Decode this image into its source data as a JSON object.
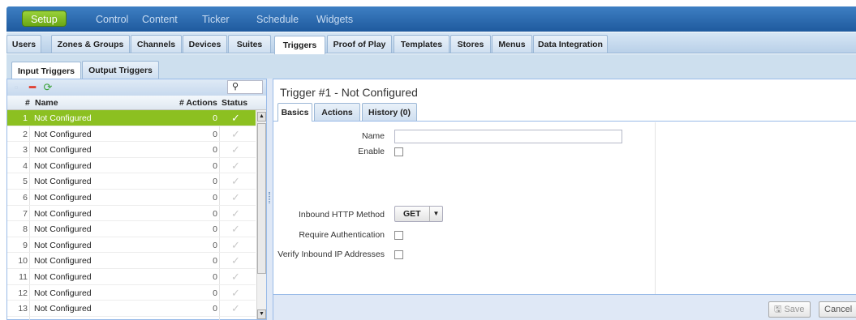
{
  "topnav": {
    "items": [
      {
        "label": "Setup",
        "active": true
      },
      {
        "label": "Control"
      },
      {
        "label": "Content"
      },
      {
        "label": "Ticker"
      },
      {
        "label": "Schedule"
      },
      {
        "label": "Widgets"
      }
    ]
  },
  "subnav": {
    "tabs": [
      {
        "label": "Users"
      },
      {
        "label": "Zones & Groups"
      },
      {
        "label": "Channels"
      },
      {
        "label": "Devices"
      },
      {
        "label": "Suites"
      },
      {
        "label": "Triggers",
        "active": true
      },
      {
        "label": "Proof of Play"
      },
      {
        "label": "Templates"
      },
      {
        "label": "Stores"
      },
      {
        "label": "Menus"
      },
      {
        "label": "Data Integration"
      }
    ]
  },
  "trigger_tabs": [
    {
      "label": "Input Triggers",
      "active": true
    },
    {
      "label": "Output Triggers"
    }
  ],
  "grid": {
    "search_icon": "search-icon",
    "headers": {
      "num": "#",
      "name": "Name",
      "actions": "# Actions",
      "status": "Status"
    },
    "rows": [
      {
        "num": "1",
        "name": "Not Configured",
        "actions": "0",
        "selected": true
      },
      {
        "num": "2",
        "name": "Not Configured",
        "actions": "0"
      },
      {
        "num": "3",
        "name": "Not Configured",
        "actions": "0"
      },
      {
        "num": "4",
        "name": "Not Configured",
        "actions": "0"
      },
      {
        "num": "5",
        "name": "Not Configured",
        "actions": "0"
      },
      {
        "num": "6",
        "name": "Not Configured",
        "actions": "0"
      },
      {
        "num": "7",
        "name": "Not Configured",
        "actions": "0"
      },
      {
        "num": "8",
        "name": "Not Configured",
        "actions": "0"
      },
      {
        "num": "9",
        "name": "Not Configured",
        "actions": "0"
      },
      {
        "num": "10",
        "name": "Not Configured",
        "actions": "0"
      },
      {
        "num": "11",
        "name": "Not Configured",
        "actions": "0"
      },
      {
        "num": "12",
        "name": "Not Configured",
        "actions": "0"
      },
      {
        "num": "13",
        "name": "Not Configured",
        "actions": "0"
      }
    ],
    "check_glyph": "✓"
  },
  "detail": {
    "title": "Trigger #1 - Not Configured",
    "tabs": [
      {
        "label": "Basics",
        "active": true
      },
      {
        "label": "Actions"
      },
      {
        "label": "History (0)"
      }
    ],
    "form": {
      "name_label": "Name",
      "name_value": "",
      "enable_label": "Enable",
      "method_label": "Inbound HTTP Method",
      "method_value": "GET",
      "auth_label": "Require Authentication",
      "verify_ip_label": "Verify Inbound IP Addresses"
    },
    "buttons": {
      "save": "Save",
      "cancel": "Cancel"
    }
  },
  "colors": {
    "selected_row": "#8cc021",
    "nav_blue": "#2c6cb0",
    "active_green": "#7dbb1e"
  }
}
